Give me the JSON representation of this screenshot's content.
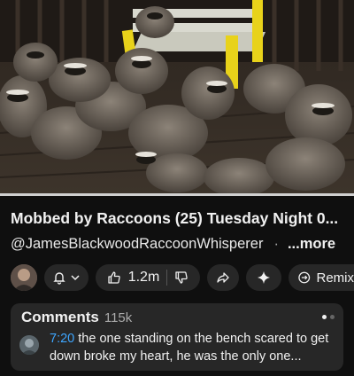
{
  "video": {
    "progress_fraction": 1.0,
    "scene": "raccoons gathered on a wooden deck around a yellow bench"
  },
  "title": "Mobbed by Raccoons  (25)  Tuesday Night 0...",
  "channel": {
    "handle": "@JamesBlackwoodRaccoonWhisperer",
    "more_label": "...more"
  },
  "actions": {
    "like_count": "1.2m",
    "remix_label": "Remix"
  },
  "comments": {
    "heading": "Comments",
    "count": "115k",
    "top_comment": {
      "timestamp": "7:20",
      "text": " the one standing on the bench scared to get down broke my heart, he was the only one..."
    }
  },
  "colors": {
    "background": "#0f0f0f",
    "surface": "#272727",
    "timestamp_link": "#3ea6ff",
    "bench_yellow": "#e8d21a"
  }
}
